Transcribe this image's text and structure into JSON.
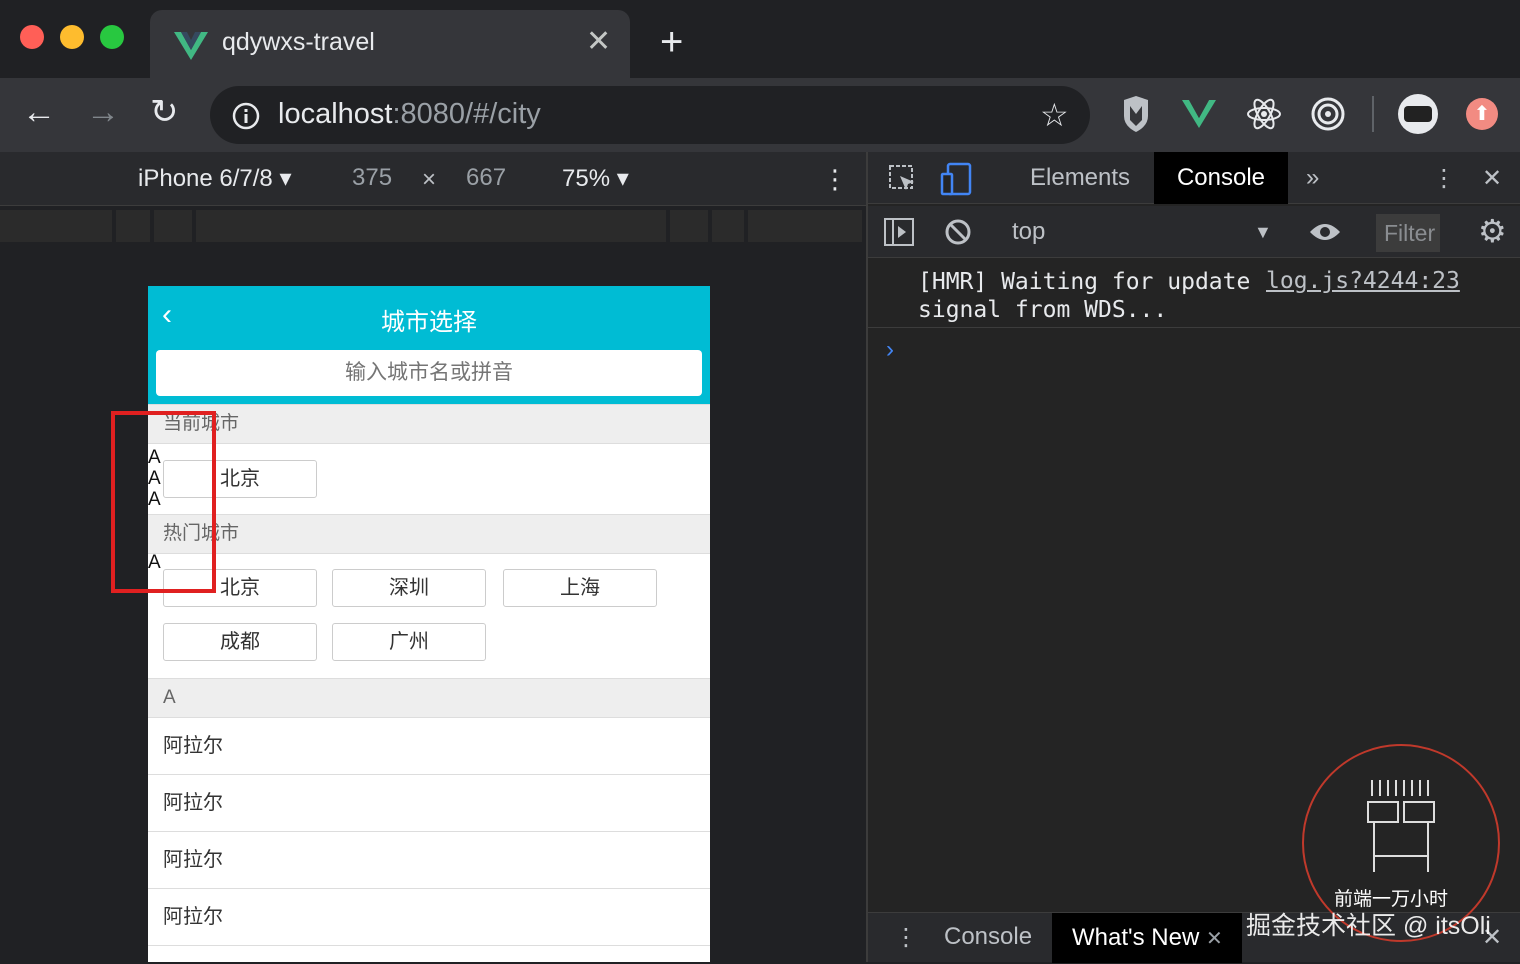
{
  "browser": {
    "tab_title": "qdywxs-travel",
    "url_host": "localhost",
    "url_rest": ":8080/#/city"
  },
  "device_toolbar": {
    "device": "iPhone 6/7/8",
    "width": "375",
    "times": "×",
    "height": "667",
    "zoom": "75%"
  },
  "phone": {
    "title": "城市选择",
    "search_placeholder": "输入城市名或拼音",
    "current_section": "当前城市",
    "current_city": "北京",
    "hot_section": "热门城市",
    "hot_cities": [
      "北京",
      "深圳",
      "上海",
      "成都",
      "广州"
    ],
    "letter_section": "A",
    "list_items": [
      "阿拉尔",
      "阿拉尔",
      "阿拉尔",
      "阿拉尔"
    ],
    "alphabet_overlay": [
      "A",
      "A",
      "A",
      "A"
    ]
  },
  "devtools": {
    "tab_elements": "Elements",
    "tab_console": "Console",
    "context": "top",
    "filter_placeholder": "Filter",
    "log_message": "[HMR] Waiting for update signal from WDS...",
    "log_source": "log.js?4244:23",
    "prompt": "›",
    "drawer_console": "Console",
    "drawer_whatsnew": "What's New"
  },
  "watermark": {
    "line1": "前端一万小时",
    "line2": "掘金技术社区 @ itsOli"
  },
  "colors": {
    "header": "#00bcd4",
    "highlight": "#e02020"
  }
}
